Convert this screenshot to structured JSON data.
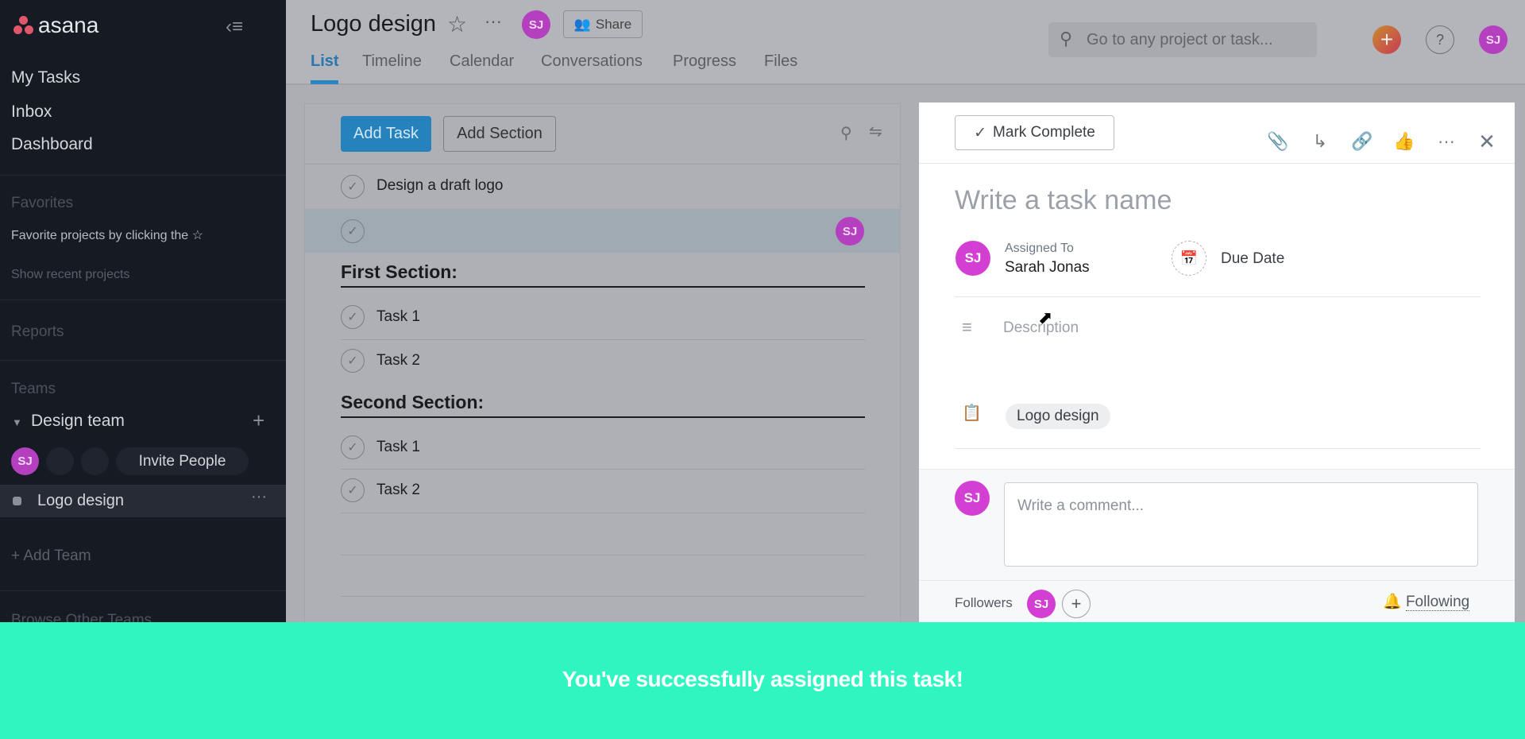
{
  "sidebar": {
    "logo": "asana",
    "nav": [
      "My Tasks",
      "Inbox",
      "Dashboard"
    ],
    "favorites_heading": "Favorites",
    "favorites_hint": "Favorite projects by clicking the",
    "show_recent": "Show recent projects",
    "reports": "Reports",
    "teams_heading": "Teams",
    "team_name": "Design team",
    "member_initials": "SJ",
    "invite": "Invite People",
    "project": "Logo design",
    "add_team": "Add Team",
    "browse": "Browse Other Teams"
  },
  "header": {
    "title": "Logo design",
    "avatar": "SJ",
    "share": "Share",
    "tabs": [
      "List",
      "Timeline",
      "Calendar",
      "Conversations",
      "Progress",
      "Files"
    ],
    "active_tab": "List",
    "search_placeholder": "Go to any project or task...",
    "user": "SJ"
  },
  "list": {
    "add_task": "Add Task",
    "add_section": "Add Section",
    "tasks": [
      {
        "name": "Design a draft logo"
      },
      {
        "name": "",
        "assignee": "SJ"
      }
    ],
    "sections": [
      {
        "title": "First Section:",
        "tasks": [
          "Task 1",
          "Task 2"
        ]
      },
      {
        "title": "Second Section:",
        "tasks": [
          "Task 1",
          "Task 2"
        ]
      }
    ]
  },
  "detail": {
    "mark_complete": "Mark Complete",
    "name_placeholder": "Write a task name",
    "assigned_label": "Assigned To",
    "assignee": "Sarah Jonas",
    "assignee_initials": "SJ",
    "due_date": "Due Date",
    "description_placeholder": "Description",
    "project": "Logo design",
    "comment_placeholder": "Write a comment...",
    "followers_label": "Followers",
    "following": "Following"
  },
  "toast": {
    "message": "You've successfully assigned this task!"
  },
  "colors": {
    "accent": "#2e8fce",
    "avatar": "#b43fbf",
    "toast": "#2ff6c1"
  }
}
